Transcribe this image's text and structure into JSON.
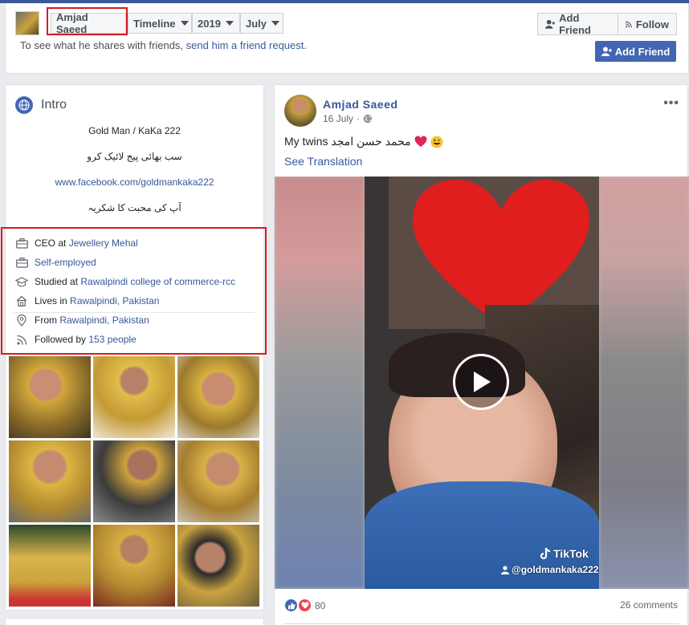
{
  "header": {
    "profile_name": "Amjad Saeed",
    "timeline_label": "Timeline",
    "year_label": "2019",
    "month_label": "July",
    "add_friend_label": "Add Friend",
    "follow_label": "Follow",
    "friend_message": "To see what he shares with friends, ",
    "friend_request_link": "send him a friend request.",
    "add_friend_primary": "Add Friend"
  },
  "intro": {
    "title": "Intro",
    "bio_lines": [
      "Gold Man / KaKa 222",
      "سب بھائی پیج لائیک کرو",
      "www.facebook.com/goldmankaka222",
      "آپ کی محبت کا شکریہ"
    ],
    "details": [
      {
        "prefix": "CEO at ",
        "link": "Jewellery Mehal",
        "icon": "briefcase-icon"
      },
      {
        "prefix": "",
        "link": "Self-employed",
        "icon": "briefcase-icon"
      },
      {
        "prefix": "Studied at ",
        "link": "Rawalpindi college of commerce-rcc",
        "icon": "graduation-cap-icon"
      },
      {
        "prefix": "Lives in ",
        "link": "Rawalpindi, Pakistan",
        "icon": "home-icon"
      },
      {
        "prefix": "From ",
        "link": "Rawalpindi, Pakistan",
        "icon": "location-pin-icon"
      },
      {
        "prefix": "Followed by ",
        "link": "153 people",
        "icon": "rss-icon"
      }
    ]
  },
  "post": {
    "author": "Amjad Saeed",
    "date": "16 July",
    "separator": "·",
    "text": "My twins محمد حسن امجد",
    "see_translation": "See Translation",
    "tiktok_label": "TikTok",
    "tiktok_user": "@goldmankaka222",
    "reaction_count": "80",
    "comments": "26 comments"
  },
  "colors": {
    "brand_blue": "#4267b2",
    "link": "#365899",
    "highlight_red": "#d71920"
  }
}
